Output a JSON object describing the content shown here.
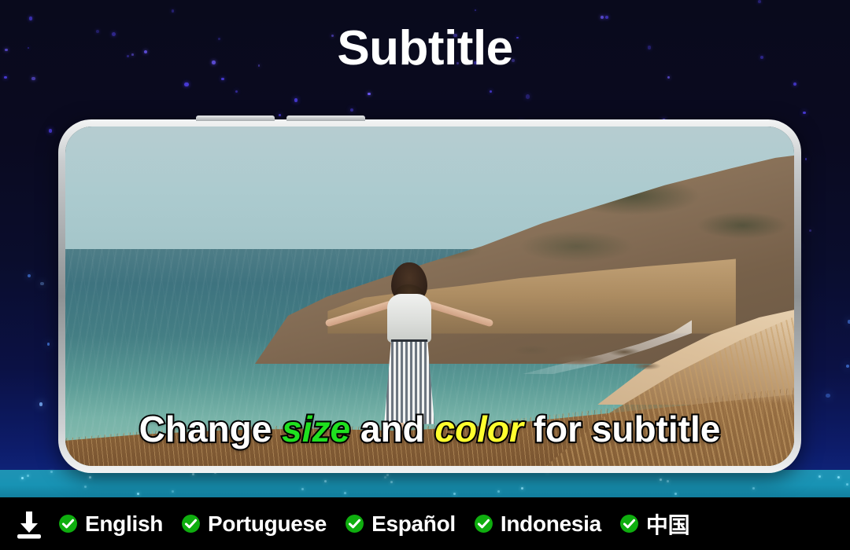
{
  "page_title": "Subtitle",
  "colors": {
    "background_top": "#090a1c",
    "background_bottom": "#0f2a86",
    "cyan_glow": "#1893b4",
    "check_green": "#0fae0f",
    "caption_white": "#ffffff",
    "caption_green": "#1fe01f",
    "caption_yellow": "#ffff2e",
    "langbar_black": "#000000",
    "phone_bezel": "#8e9294"
  },
  "phone": {
    "buttons": [
      "volume-up-button",
      "volume-down-button"
    ],
    "screen": {
      "photo_description": "woman with outstretched arms on a coastal bluff overlooking the ocean",
      "caption_parts": [
        {
          "text": "Change ",
          "style": "white"
        },
        {
          "text": "size",
          "style": "green-italic"
        },
        {
          "text": " and ",
          "style": "white"
        },
        {
          "text": "color",
          "style": "yellow-italic"
        },
        {
          "text": " for subtitle",
          "style": "white"
        }
      ]
    }
  },
  "bottom_bar": {
    "download_icon": "download-icon",
    "languages": [
      {
        "label": "English",
        "checked": true,
        "icon": "check-circle-icon"
      },
      {
        "label": "Portuguese",
        "checked": true,
        "icon": "check-circle-icon"
      },
      {
        "label": "Español",
        "checked": true,
        "icon": "check-circle-icon"
      },
      {
        "label": "Indonesia",
        "checked": true,
        "icon": "check-circle-icon"
      },
      {
        "label": "中国",
        "checked": true,
        "icon": "check-circle-icon"
      }
    ]
  }
}
